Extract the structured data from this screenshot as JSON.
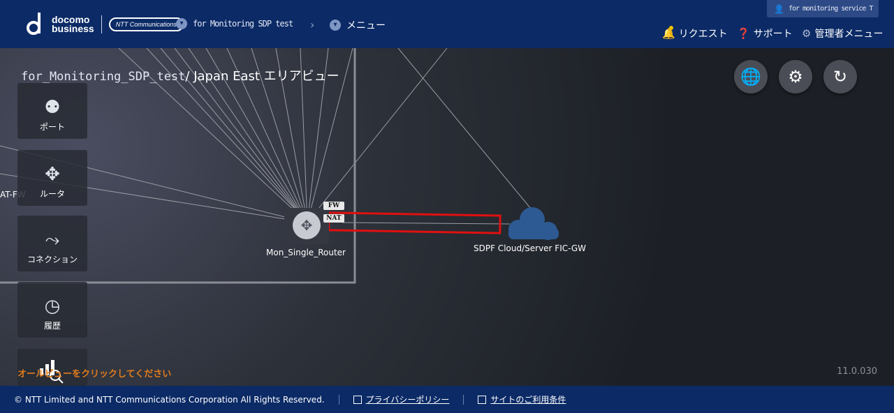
{
  "header": {
    "logo_line1": "docomo",
    "logo_line2": "business",
    "logo_ntt": "NTT Communications",
    "crumb_tenant": "for Monitoring SDP test",
    "crumb_menu": "メニュー",
    "user_name": "for monitoring service T",
    "nav_request": "リクエスト",
    "nav_support": "サポート",
    "nav_admin": "管理者メニュー"
  },
  "area": {
    "title_prefix": "for_Monitoring_SDP_test",
    "title_suffix": "/ Japan East エリアビュー"
  },
  "sidebar": {
    "items": [
      {
        "label": "ポート"
      },
      {
        "label": "ルータ"
      },
      {
        "label": "コネクション"
      },
      {
        "label": "履歴"
      }
    ]
  },
  "graph": {
    "router_label": "Mon_Single_Router",
    "cloud_label": "SDPF Cloud/Server FIC-GW",
    "offscreen_label": "AT-FW",
    "tag_fw": "FW",
    "tag_nat": "NAT"
  },
  "hint_text": "オールビューをクリックしてください",
  "version": "11.0.030",
  "footer": {
    "copyright": "© NTT Limited and NTT Communications Corporation All Rights Reserved.",
    "privacy": "プライバシーポリシー",
    "terms": "サイトのご利用条件"
  },
  "colors": {
    "header_bg": "#0b2a66",
    "hint": "#e07b1c",
    "highlight": "#e01010",
    "cloud": "#2d5a93"
  }
}
